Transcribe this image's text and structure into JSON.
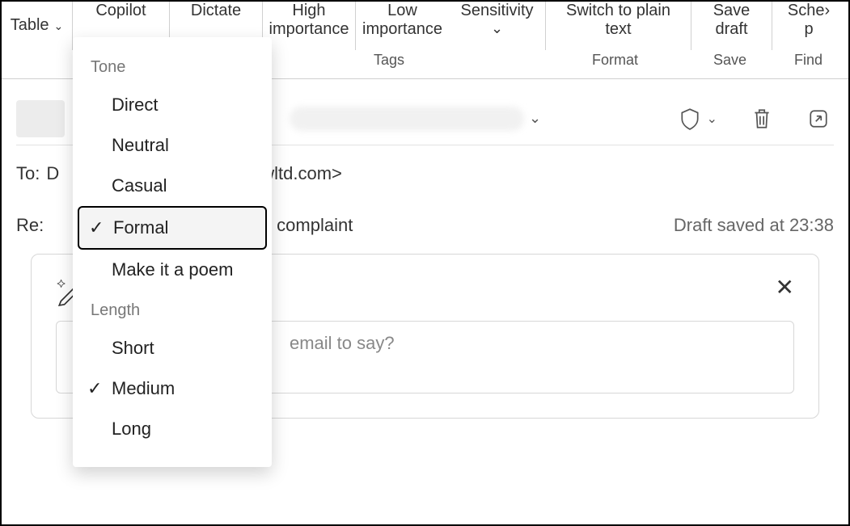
{
  "ribbon": {
    "table": "Table",
    "copilot": "Copilot",
    "dictate": "Dictate",
    "high_importance_l1": "High",
    "high_importance_l2": "importance",
    "low_importance_l1": "Low",
    "low_importance_l2": "importance",
    "sensitivity": "Sensitivity",
    "switch_l1": "Switch to plain",
    "switch_l2": "text",
    "save_draft_l1": "Save",
    "save_draft_l2": "draft",
    "sched_l1": "Sche",
    "sched_l2": "p",
    "group_tags": "Tags",
    "group_format": "Format",
    "group_save": "Save",
    "group_find": "Find"
  },
  "message": {
    "to_label": "To:",
    "to_value": "D",
    "to_domain_frag": "wltd.com>",
    "subject_prefix": "Re:",
    "subject_frag": "er complaint",
    "draft_saved": "Draft saved at 23:38"
  },
  "compose": {
    "placeholder_frag": "email to say?"
  },
  "dropdown": {
    "tone_header": "Tone",
    "tone_items": [
      "Direct",
      "Neutral",
      "Casual",
      "Formal",
      "Make it a poem"
    ],
    "tone_selected_index": 3,
    "length_header": "Length",
    "length_items": [
      "Short",
      "Medium",
      "Long"
    ],
    "length_selected_index": 1
  }
}
